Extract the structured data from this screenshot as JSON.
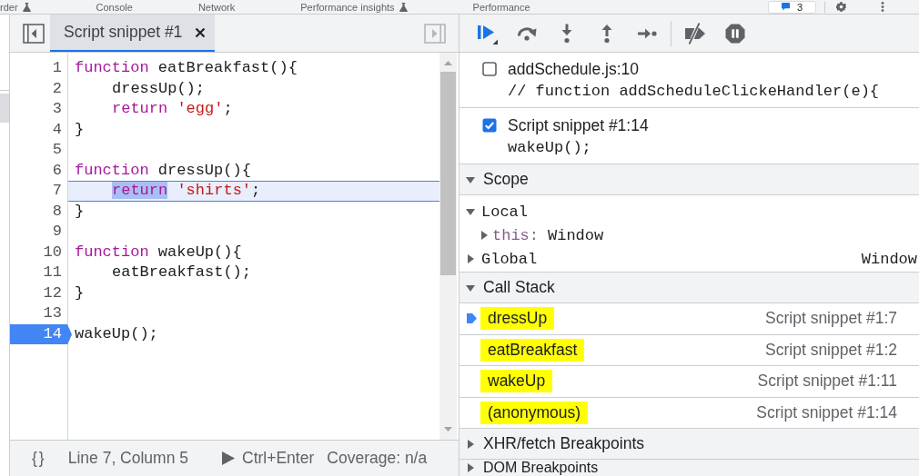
{
  "panel_tabs": [
    {
      "label": "rder",
      "experimental": true,
      "selected": false
    },
    {
      "label": "Console",
      "experimental": false,
      "selected": false
    },
    {
      "label": "Network",
      "experimental": false,
      "selected": false
    },
    {
      "label": "Performance insights",
      "experimental": true,
      "selected": false
    },
    {
      "label": "Performance",
      "experimental": false,
      "selected": false
    }
  ],
  "issues_counter": {
    "count": "3"
  },
  "editor": {
    "tabs": [
      {
        "label": "Script snippet #1",
        "selected": true
      }
    ],
    "lines": [
      {
        "number": "1",
        "indented": false,
        "breakpoint": false,
        "paused": false,
        "tokens": [
          {
            "kind": "keyword",
            "text": "function",
            "highlighted": false
          },
          {
            "kind": "plain",
            "text": " eatBreakfast(){",
            "highlighted": false
          }
        ]
      },
      {
        "number": "2",
        "indented": true,
        "breakpoint": false,
        "paused": false,
        "tokens": [
          {
            "kind": "plain",
            "text": "dressUp();",
            "highlighted": false
          }
        ]
      },
      {
        "number": "3",
        "indented": true,
        "breakpoint": false,
        "paused": false,
        "tokens": [
          {
            "kind": "keyword",
            "text": "return",
            "highlighted": false
          },
          {
            "kind": "string",
            "text": " 'egg'",
            "highlighted": false
          },
          {
            "kind": "plain",
            "text": ";",
            "highlighted": false
          }
        ]
      },
      {
        "number": "4",
        "indented": false,
        "breakpoint": false,
        "paused": false,
        "tokens": [
          {
            "kind": "plain",
            "text": "}",
            "highlighted": false
          }
        ]
      },
      {
        "number": "5",
        "breakpoint": false,
        "paused": false
      },
      {
        "number": "6",
        "indented": false,
        "breakpoint": false,
        "paused": false,
        "tokens": [
          {
            "kind": "keyword",
            "text": "function",
            "highlighted": false
          },
          {
            "kind": "plain",
            "text": " dressUp(){",
            "highlighted": false
          }
        ]
      },
      {
        "number": "7",
        "indented": true,
        "breakpoint": false,
        "paused": true,
        "tokens": [
          {
            "kind": "keyword",
            "text": "return",
            "highlighted": true
          },
          {
            "kind": "string",
            "text": " 'shirts'",
            "highlighted": false
          },
          {
            "kind": "plain",
            "text": ";",
            "highlighted": false
          }
        ]
      },
      {
        "number": "8",
        "indented": false,
        "breakpoint": false,
        "paused": false,
        "tokens": [
          {
            "kind": "plain",
            "text": "}",
            "highlighted": false
          }
        ]
      },
      {
        "number": "9",
        "breakpoint": false,
        "paused": false
      },
      {
        "number": "10",
        "indented": false,
        "breakpoint": false,
        "paused": false,
        "tokens": [
          {
            "kind": "keyword",
            "text": "function",
            "highlighted": false
          },
          {
            "kind": "plain",
            "text": " wakeUp(){",
            "highlighted": false
          }
        ]
      },
      {
        "number": "11",
        "indented": true,
        "breakpoint": false,
        "paused": false,
        "tokens": [
          {
            "kind": "plain",
            "text": "eatBreakfast();",
            "highlighted": false
          }
        ]
      },
      {
        "number": "12",
        "indented": false,
        "breakpoint": false,
        "paused": false,
        "tokens": [
          {
            "kind": "plain",
            "text": "}",
            "highlighted": false
          }
        ]
      },
      {
        "number": "13",
        "breakpoint": false,
        "paused": false
      },
      {
        "number": "14",
        "indented": false,
        "breakpoint": true,
        "paused": false,
        "tokens": [
          {
            "kind": "plain",
            "text": "wakeUp();",
            "highlighted": false
          }
        ]
      }
    ],
    "status_bar": {
      "format_label": "{}",
      "cursor_position": "Line 7, Column 5",
      "run_shortcut": "Ctrl+Enter",
      "coverage": "Coverage: n/a"
    }
  },
  "debugger": {
    "toolbar_groups": [
      {
        "buttons": [
          {
            "kind": "resume"
          },
          {
            "kind": "step_over"
          },
          {
            "kind": "step_into"
          },
          {
            "kind": "step_out"
          },
          {
            "kind": "step"
          }
        ]
      },
      {
        "buttons": [
          {
            "kind": "deactivate_breakpoints"
          },
          {
            "kind": "pause_on_exceptions"
          }
        ]
      }
    ],
    "breakpoints": [
      {
        "location": "addSchedule.js:10",
        "code": "// function addScheduleClickeHandler(e){",
        "checked": false
      },
      {
        "location": "Script snippet #1:14",
        "code": "wakeUp();",
        "checked": true
      }
    ],
    "scope": {
      "title": "Scope",
      "expanded": true,
      "items": [
        {
          "kind": "scope",
          "name": "Local",
          "expanded": true,
          "children": [
            {
              "kind": "property",
              "name": "this:",
              "value": "Window",
              "expanded": false
            }
          ]
        },
        {
          "kind": "scope",
          "name": "Global",
          "value": "Window",
          "expanded": false
        }
      ]
    },
    "call_stack": {
      "title": "Call Stack",
      "expanded": true,
      "frames": [
        {
          "name": "dressUp",
          "location": "Script snippet #1:7",
          "current": true,
          "highlighted": true
        },
        {
          "name": "eatBreakfast",
          "location": "Script snippet #1:2",
          "current": false,
          "highlighted": true
        },
        {
          "name": "wakeUp",
          "location": "Script snippet #1:11",
          "current": false,
          "highlighted": true
        },
        {
          "name": "(anonymous)",
          "location": "Script snippet #1:14",
          "current": false,
          "highlighted": true
        }
      ]
    },
    "collapsed_sections": [
      {
        "title": "XHR/fetch Breakpoints",
        "expanded": false
      },
      {
        "title": "DOM Breakpoints",
        "expanded": false
      }
    ]
  }
}
